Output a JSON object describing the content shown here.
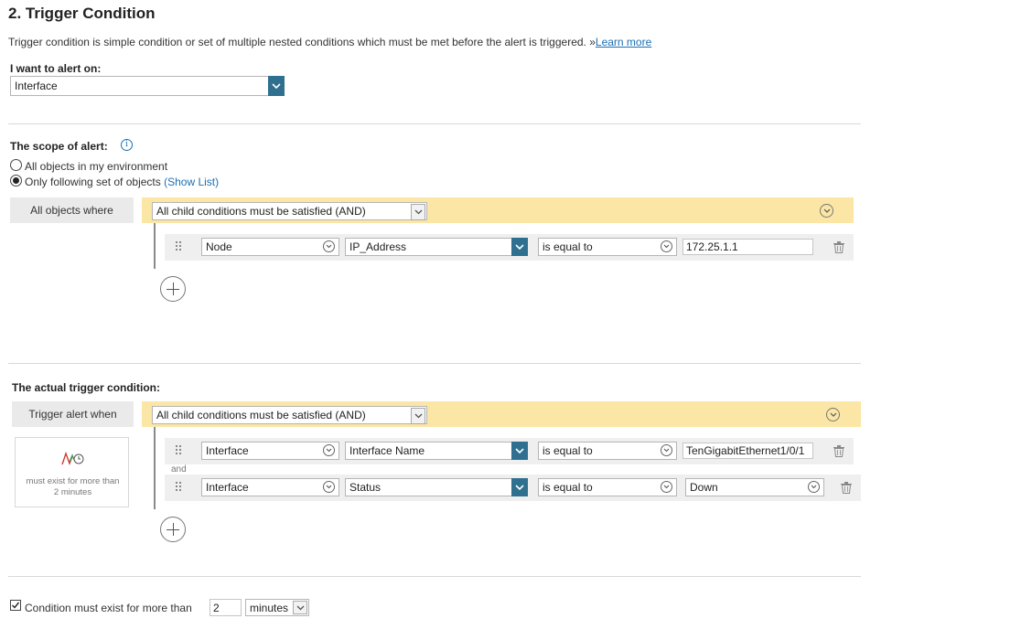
{
  "header": {
    "title": "2. Trigger Condition",
    "description": "Trigger condition is simple condition or set of multiple nested conditions which must be met before the alert is triggered. »",
    "learn_more": "Learn more"
  },
  "alert_on": {
    "label": "I want to alert on:",
    "value": "Interface"
  },
  "scope": {
    "label": "The scope of alert:",
    "option_all": "All objects in my environment",
    "option_following": "Only following set of objects",
    "show_list": "(Show List)",
    "selected": "Only following set of objects",
    "group_label": "All objects where",
    "group_operator": "All child conditions must be satisfied (AND)",
    "conditions": [
      {
        "object": "Node",
        "field": "IP_Address",
        "operator": "is equal to",
        "value": "172.25.1.1"
      }
    ]
  },
  "trigger": {
    "label": "The actual trigger condition:",
    "group_label": "Trigger alert when",
    "group_operator": "All child conditions must be satisfied (AND)",
    "time_hint": "must exist for more than 2 minutes",
    "joiner": "and",
    "conditions": [
      {
        "object": "Interface",
        "field": "Interface Name",
        "operator": "is equal to",
        "value": "TenGigabitEthernet1/0/1"
      },
      {
        "object": "Interface",
        "field": "Status",
        "operator": "is equal to",
        "value": "Down"
      }
    ]
  },
  "duration": {
    "checked": true,
    "label": "Condition must exist for more than",
    "amount": "2",
    "unit": "minutes"
  },
  "colors": {
    "accent": "#2f6f8f",
    "group_bar": "#fbe6a6",
    "link": "#1a6fb5",
    "chart_red": "#d0302a",
    "chart_green": "#3aa05a"
  }
}
